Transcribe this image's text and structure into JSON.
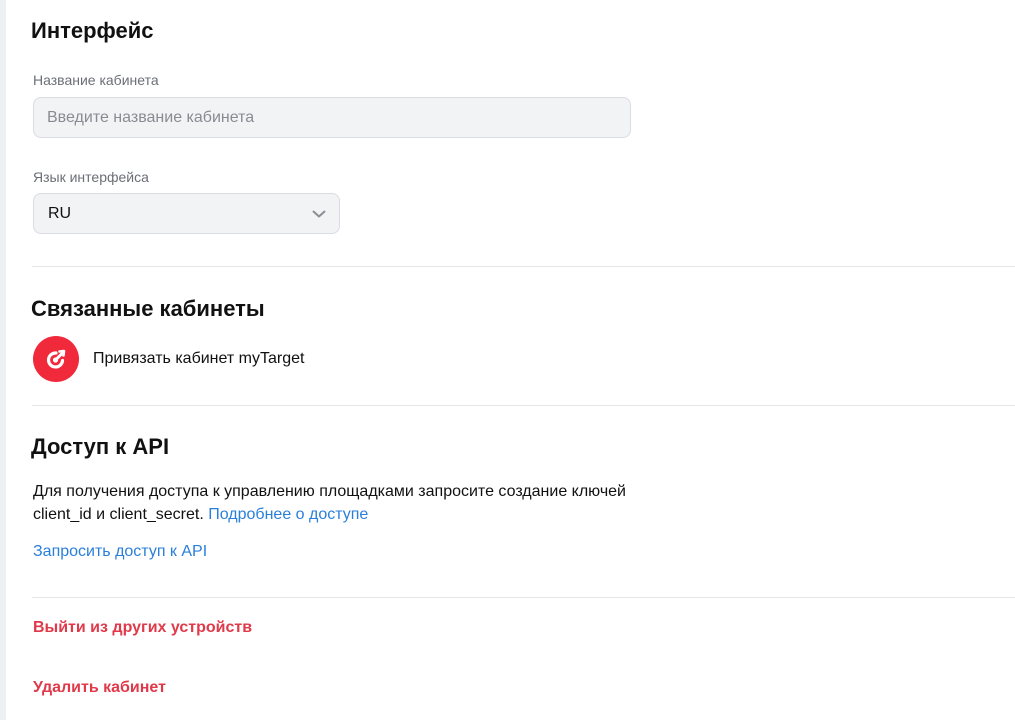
{
  "interface": {
    "title": "Интерфейс",
    "cabinet_name_label": "Название кабинета",
    "cabinet_name_placeholder": "Введите название кабинета",
    "cabinet_name_value": "",
    "language_label": "Язык интерфейса",
    "language_value": "RU"
  },
  "linked": {
    "title": "Связанные кабинеты",
    "mytarget_label": "Привязать кабинет myTarget",
    "mytarget_logo_color": "#f0293b"
  },
  "api": {
    "title": "Доступ к API",
    "description": "Для получения доступа к управлению площадками запросите создание ключей client_id и client_secret.",
    "more_link": "Подробнее о доступе",
    "request_link": "Запросить доступ к API"
  },
  "actions": {
    "logout_others": "Выйти из других устройств",
    "delete_cabinet": "Удалить кабинет"
  },
  "colors": {
    "accent_link": "#2a7fdb",
    "danger": "#e0394a"
  }
}
